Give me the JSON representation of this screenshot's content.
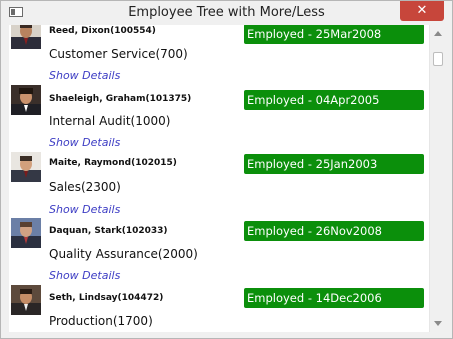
{
  "window": {
    "title": "Employee Tree with More/Less"
  },
  "employees": [
    {
      "name": "Reed, Dixon(100554)",
      "status": "Employed - 25Mar2008",
      "department": "Customer Service(700)",
      "details_link": "Show Details"
    },
    {
      "name": "Shaeleigh, Graham(101375)",
      "status": "Employed - 04Apr2005",
      "department": "Internal Audit(1000)",
      "details_link": "Show Details"
    },
    {
      "name": "Maite, Raymond(102015)",
      "status": "Employed - 25Jan2003",
      "department": "Sales(2300)",
      "details_link": "Show Details"
    },
    {
      "name": "Daquan, Stark(102033)",
      "status": "Employed - 26Nov2008",
      "department": "Quality Assurance(2000)",
      "details_link": "Show Details"
    },
    {
      "name": "Seth, Lindsay(104472)",
      "status": "Employed - 14Dec2006",
      "department": "Production(1700)",
      "details_link": ""
    }
  ],
  "colors": {
    "status_badge": "#0b8f0b",
    "link": "#3d3dc4",
    "close_button": "#c7463b"
  },
  "icons": [
    "app-window-icon",
    "close-icon",
    "scroll-up-arrow-icon",
    "scroll-down-arrow-icon"
  ]
}
